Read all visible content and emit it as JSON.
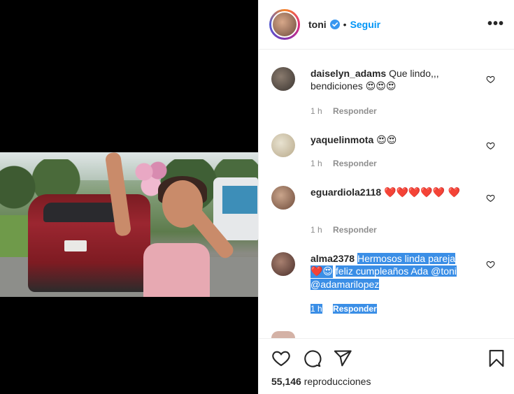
{
  "post": {
    "author": "toni",
    "separator": "•",
    "follow_label": "Seguir",
    "more_label": "•••"
  },
  "comments": [
    {
      "user": "daiselyn_adams",
      "text": "Que lindo,,, bendiciones",
      "emojis": "😍😍😍",
      "time": "1 h",
      "reply": "Responder"
    },
    {
      "user": "yaquelinmota",
      "text": "",
      "emojis": "😍😍",
      "time": "1 h",
      "reply": "Responder"
    },
    {
      "user": "eguardiola2118",
      "text": "",
      "emojis": "❤️❤️❤️❤️❤️ ❤️",
      "time": "1 h",
      "reply": "Responder"
    },
    {
      "user": "alma2378",
      "text_a": "Hermosos linda pareja",
      "emojis": "❤️😍",
      "text_b": "feliz cumpleaños Ada @toni @adamarilopez",
      "time": "1 h",
      "reply": "Responder"
    }
  ],
  "stats": {
    "views_count": "55,146",
    "views_label": "reproducciones"
  },
  "colors": {
    "accent": "#0095f6",
    "highlight": "#3a8ee6",
    "heart_red": "#ed4956"
  },
  "icons": [
    "verified-badge-icon",
    "more-options-icon",
    "like-heart-icon",
    "comment-icon",
    "share-icon",
    "save-bookmark-icon",
    "comment-like-heart-icon"
  ]
}
